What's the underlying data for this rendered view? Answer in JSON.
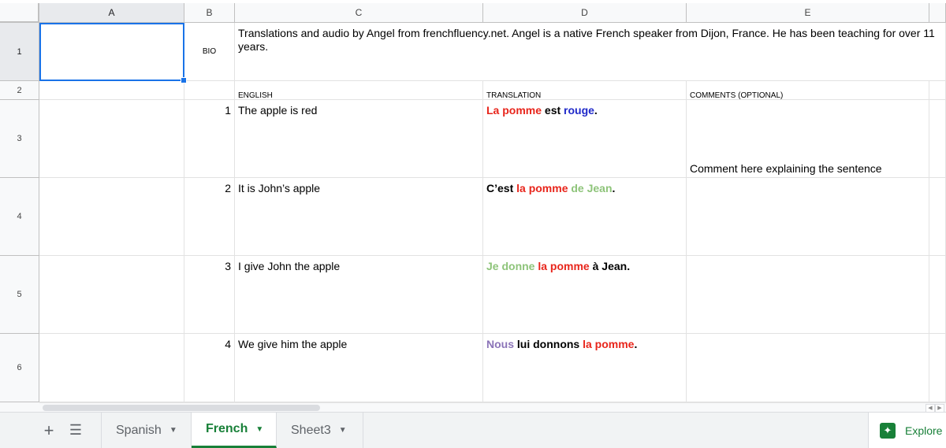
{
  "columns": [
    "A",
    "B",
    "C",
    "D",
    "E"
  ],
  "rows": [
    "1",
    "2",
    "3",
    "4",
    "5",
    "6"
  ],
  "cells": {
    "b1": "BIO",
    "c1": "Translations and audio by Angel from frenchfluency.net. Angel is a native French speaker from Dijon, France. He has been teaching for over 11 years.",
    "c2": "ENGLISH",
    "d2": "TRANSLATION",
    "e2": "COMMENTS (OPTIONAL)",
    "e3": "Comment here explaining the sentence"
  },
  "entries": [
    {
      "number": "1",
      "english": "The apple is red",
      "translation": [
        {
          "text": "La pomme",
          "color": "red"
        },
        {
          "text": " est ",
          "color": "black"
        },
        {
          "text": "rouge",
          "color": "blue"
        },
        {
          "text": ".",
          "color": "black"
        }
      ]
    },
    {
      "number": "2",
      "english": "It is John’s apple",
      "translation": [
        {
          "text": "C’est ",
          "color": "black"
        },
        {
          "text": "la pomme",
          "color": "red"
        },
        {
          "text": " de Jean",
          "color": "green"
        },
        {
          "text": ".",
          "color": "black"
        }
      ]
    },
    {
      "number": "3",
      "english": "I give John the apple",
      "translation": [
        {
          "text": "Je donne ",
          "color": "green"
        },
        {
          "text": "la pomme",
          "color": "red"
        },
        {
          "text": " à Jean.",
          "color": "black"
        }
      ]
    },
    {
      "number": "4",
      "english": "We give him the apple",
      "translation": [
        {
          "text": "Nous",
          "color": "purple"
        },
        {
          "text": " lui donnons ",
          "color": "black"
        },
        {
          "text": "la pomme",
          "color": "red"
        },
        {
          "text": ".",
          "color": "black"
        }
      ]
    }
  ],
  "colors": {
    "red": "#e8251b",
    "blue": "#1f29c9",
    "green": "#8ec47a",
    "purple": "#8b74b8",
    "black": "#000000",
    "accent": "#188038",
    "selection": "#1a73e8"
  },
  "sheet_tabs": [
    {
      "label": "Spanish",
      "active": false
    },
    {
      "label": "French",
      "active": true
    },
    {
      "label": "Sheet3",
      "active": false
    }
  ],
  "explore_label": "Explore",
  "icons": {
    "add_sheet": "plus-icon",
    "all_sheets": "list-icon",
    "explore": "explore-icon"
  }
}
